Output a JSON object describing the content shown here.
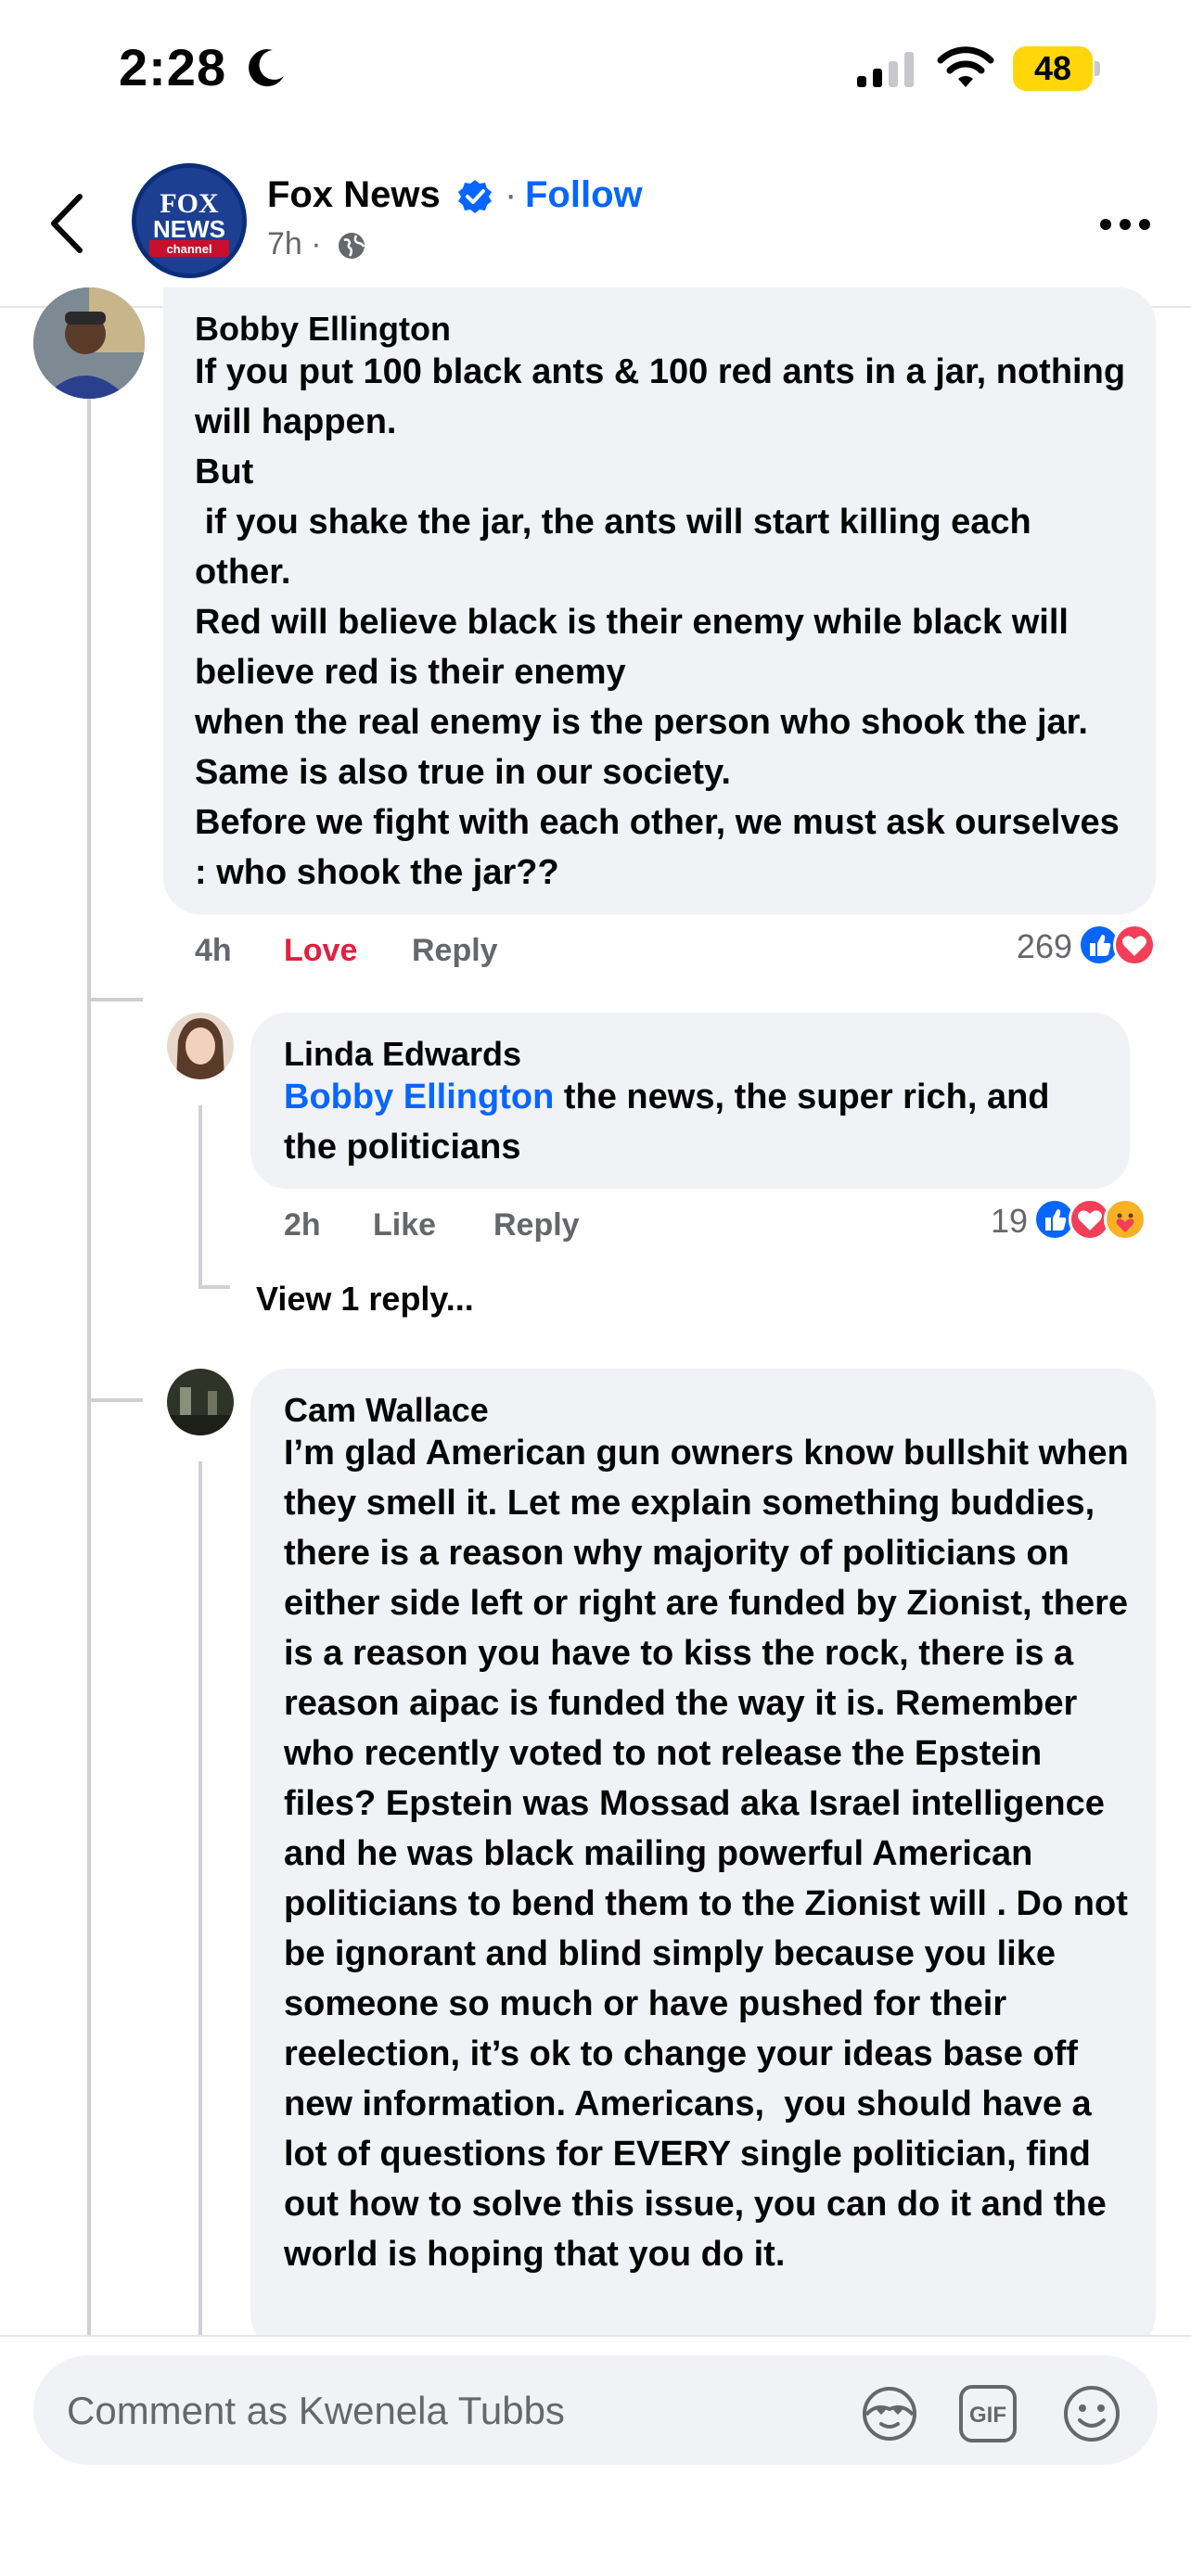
{
  "status": {
    "time": "2:28",
    "battery": "48"
  },
  "header": {
    "page_name": "Fox News",
    "separator": "·",
    "follow": "Follow",
    "post_time": "7h ·",
    "logo_text_top": "FOX",
    "logo_text_mid": "NEWS",
    "logo_text_bottom": "channel"
  },
  "comments": [
    {
      "author": "Bobby Ellington",
      "text": "If you put 100 black ants & 100 red ants in a jar, nothing will happen.\nBut\n if you shake the jar, the ants will start killing each other.\nRed will believe black is their enemy while black will believe red is their enemy\nwhen the real enemy is the person who shook the jar. Same is also true in our society.\nBefore we fight with each other, we must ask ourselves : who shook the jar??",
      "time": "4h",
      "action_react": "Love",
      "action_reply": "Reply",
      "reaction_count": "269",
      "reactions": [
        "like",
        "love"
      ]
    },
    {
      "author": "Linda Edwards",
      "mention": "Bobby Ellington",
      "text": " the news, the super rich, and the politicians",
      "time": "2h",
      "action_react": "Like",
      "action_reply": "Reply",
      "reaction_count": "19",
      "reactions": [
        "like",
        "love",
        "care"
      ],
      "view_replies": "View 1 reply..."
    },
    {
      "author": "Cam Wallace",
      "text": "I’m glad American gun owners know bullshit when they smell it. Let me explain something buddies, there is a reason why majority of politicians on either side left or right are funded by Zionist, there is a reason you have to kiss the rock, there is a reason aipac is funded the way it is. Remember who recently voted to not release the Epstein files? Epstein was Mossad aka Israel intelligence and he was black mailing powerful American politicians to bend them to the Zionist will . Do not be ignorant and blind simply because you like someone so much or have pushed for their reelection, it’s ok to change your ideas base off new information. Americans,  you should have a lot of questions for EVERY single politician, find out how to solve this issue, you can do it and the world is hoping that you do it."
    }
  ],
  "composer": {
    "placeholder": "Comment as Kwenela Tubbs",
    "gif_label": "GIF"
  },
  "colors": {
    "brand_blue": "#0866ff",
    "love_red": "#e41e3f",
    "bubble_bg": "#f0f2f5",
    "meta_gray": "#65676b"
  }
}
